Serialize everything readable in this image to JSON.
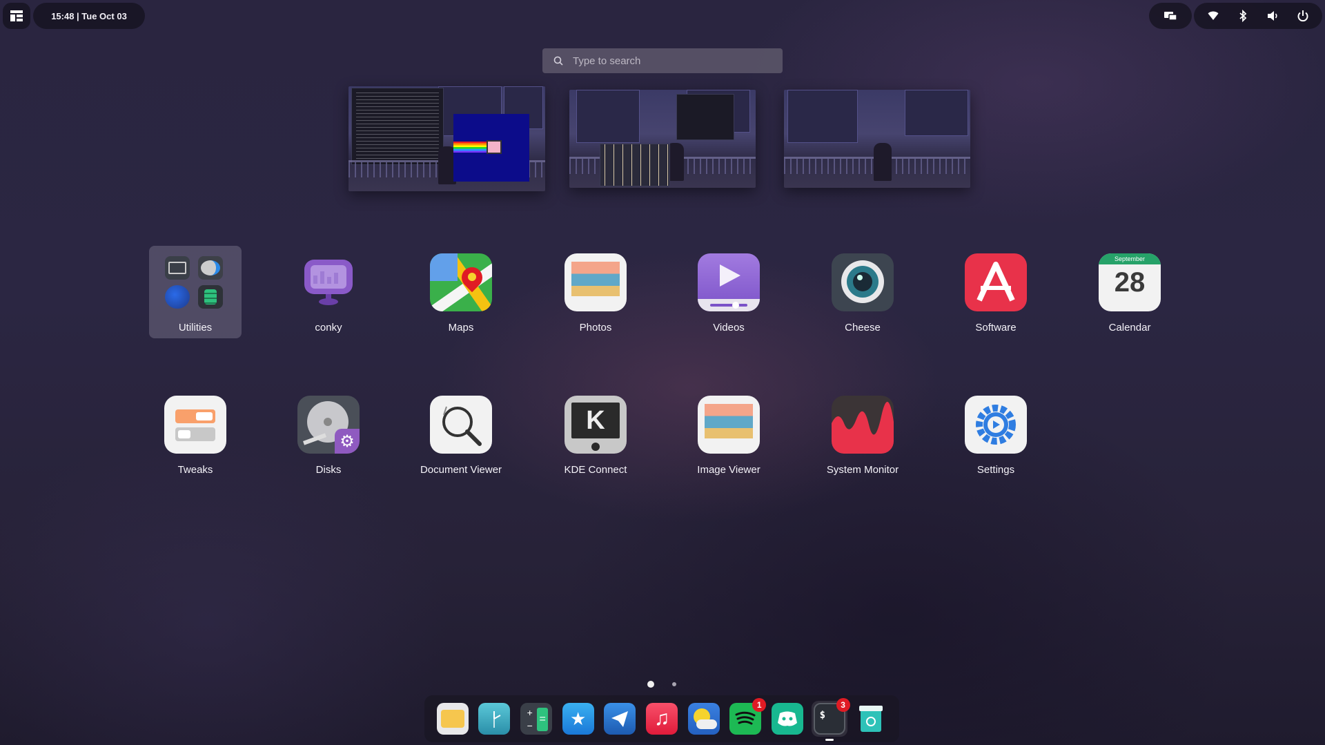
{
  "top_bar": {
    "clock": "15:48 | Tue Oct 03",
    "tray_icons": [
      "wifi-icon",
      "bluetooth-icon",
      "volume-icon",
      "power-icon"
    ]
  },
  "search": {
    "placeholder": "Type to search"
  },
  "workspaces": [
    {
      "name": "workspace-1"
    },
    {
      "name": "workspace-2"
    },
    {
      "name": "workspace-3"
    }
  ],
  "apps": {
    "row1": [
      {
        "label": "Utilities"
      },
      {
        "label": "conky"
      },
      {
        "label": "Maps"
      },
      {
        "label": "Photos"
      },
      {
        "label": "Videos"
      },
      {
        "label": "Cheese"
      },
      {
        "label": "Software"
      },
      {
        "label": "Calendar"
      }
    ],
    "row2": [
      {
        "label": "Tweaks"
      },
      {
        "label": "Disks"
      },
      {
        "label": "Document Viewer"
      },
      {
        "label": "KDE Connect"
      },
      {
        "label": "Image Viewer"
      },
      {
        "label": "System Monitor"
      },
      {
        "label": "Settings"
      }
    ]
  },
  "calendar_icon": {
    "month": "September",
    "day": "28"
  },
  "pagination": {
    "pages": 2,
    "current": 1
  },
  "dock": {
    "spotify_badge": "1",
    "terminal_badge": "3",
    "terminal_prompt": "$"
  },
  "colors": {
    "accent_badge": "#e01b24",
    "software_red": "#e8324a",
    "settings_blue": "#2f7de1"
  }
}
